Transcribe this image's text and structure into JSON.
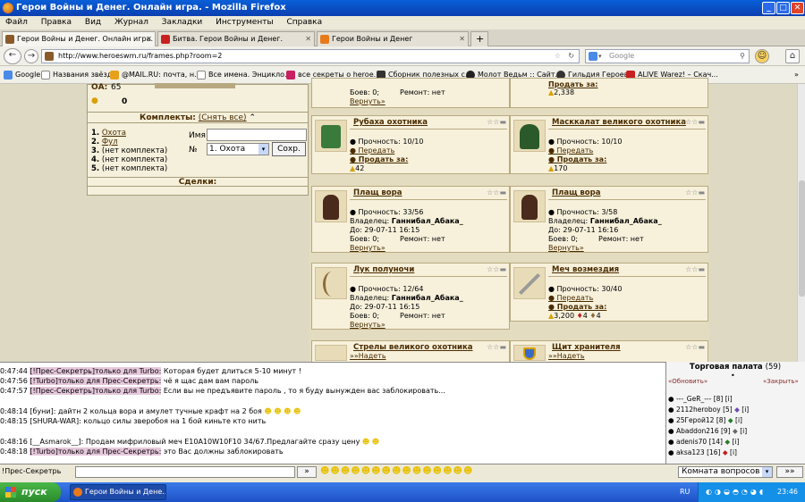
{
  "window": {
    "title": "Герои Войны и Денег. Онлайн игра. - Mozilla Firefox"
  },
  "menu": [
    "Файл",
    "Правка",
    "Вид",
    "Журнал",
    "Закладки",
    "Инструменты",
    "Справка"
  ],
  "tabs": [
    "Герои Войны и Денег. Онлайн игра.",
    "Битва. Герои Войны и Денег.",
    "Герои Войны и Денег"
  ],
  "nav": {
    "url": "http://www.heroeswm.ru/frames.php?room=2",
    "search_placeholder": "Google"
  },
  "bookmarks": [
    "Google",
    "Названия звёзд",
    "@MAIL.RU: почта, н...",
    "Все имена. Энцикло...",
    "все секреты о heroe...",
    "Сборник полезных с...",
    "Молот Ведьм :: Сайт...",
    "Гильдия Героев",
    "ALIVE Warez! – Скач..."
  ],
  "side": {
    "oa_label": "ОА:",
    "oa_value": "65",
    "gold_value": "0",
    "sets_title": "Комплекты:",
    "sets_remove": "(Снять все)",
    "name_label": "Имя",
    "num_label": "№",
    "num_select": "1. Охота",
    "save_button": "Сохр.",
    "deals_title": "Сделки:",
    "sets": [
      {
        "n": "1.",
        "t": "Охота",
        "link": true
      },
      {
        "n": "2.",
        "t": "Фул",
        "link": true
      },
      {
        "n": "3.",
        "t": "(нет комплекта)",
        "link": false
      },
      {
        "n": "4.",
        "t": "(нет комплекта)",
        "link": false
      },
      {
        "n": "5.",
        "t": "(нет комплекта)",
        "link": false
      }
    ]
  },
  "items": {
    "top_left": {
      "fight": "Боев: 0;",
      "repair": "Ремонт: нет",
      "return": "Вернуть»"
    },
    "top_right": {
      "sell": "Продать за:",
      "price": "2,338"
    },
    "i1": {
      "name": "Рубаха охотника",
      "dur": "Прочность: 10/10",
      "transfer": "Передать",
      "sell": "Продать за:",
      "price": "42"
    },
    "i2": {
      "name": "Масккалат великого охотника",
      "dur": "Прочность: 10/10",
      "transfer": "Передать",
      "sell": "Продать за:",
      "price": "170"
    },
    "i3": {
      "name": "Плащ вора",
      "dur": "Прочность: 33/56",
      "owner_label": "Владелец:",
      "owner": "Ганнибал_Абака_",
      "until": "До: 29-07-11 16:15",
      "fights": "Боев: 0;",
      "repair": "Ремонт: нет",
      "return": "Вернуть»"
    },
    "i4": {
      "name": "Плащ вора",
      "dur": "Прочность: 3/58",
      "owner_label": "Владелец:",
      "owner": "Ганнибал_Абака_",
      "until": "До: 29-07-11 16:16",
      "fights": "Боев: 0;",
      "repair": "Ремонт: нет",
      "return": "Вернуть»"
    },
    "i5": {
      "name": "Лук полуночи",
      "dur": "Прочность: 12/64",
      "owner_label": "Владелец:",
      "owner": "Ганнибал_Абака_",
      "until": "До: 29-07-11 16:15",
      "fights": "Боев: 0;",
      "repair": "Ремонт: нет",
      "return": "Вернуть»"
    },
    "i6": {
      "name": "Меч возмездия",
      "dur": "Прочность: 30/40",
      "transfer": "Передать",
      "sell": "Продать за:",
      "price": "3,200",
      "att": "4",
      "def": "4"
    },
    "i7": {
      "name": "Стрелы великого охотника",
      "wear": "»»Надеть"
    },
    "i8": {
      "name": "Щит хранителя",
      "wear": "»»Надеть"
    }
  },
  "chat": [
    {
      "time": "0:47:44",
      "nick": "[!Прес-Секретрь]",
      "to": "только для Turbo:",
      "text": "Которая будет длиться 5-10 минут !",
      "pink": true
    },
    {
      "time": "0:47:56",
      "nick": "[!Turbo]",
      "to": "только для Прес-Секретрь:",
      "text": "чё я щас дам вам пароль",
      "pink": true
    },
    {
      "time": "0:47:57",
      "nick": "[!Прес-Секретрь]",
      "to": "только для Turbo:",
      "text": "Если вы не предъявите пароль , то я буду вынужден вас заблокировать...",
      "pink": true
    },
    {
      "time": "0:48:14",
      "nick": "[буни]:",
      "to": "",
      "text": "дайтн 2 кольца вора и амулет тучные крафт на 2 боя",
      "pink": false
    },
    {
      "time": "0:48:15",
      "nick": "[SHURA-WAR]:",
      "to": "",
      "text": "кольцо силы зверобоя на 1 бой киньте кто нить",
      "pink": false
    },
    {
      "time": "0:48:16",
      "nick": "[__Asmarok__]:",
      "to": "",
      "text": "Продам мифриловый меч E10A10W10F10 34/67.Предлагайте сразу цену",
      "pink": false
    },
    {
      "time": "0:48:18",
      "nick": "[!Turbo]",
      "to": "только для Прес-Секретрь:",
      "text": "это Вас должны заблокировать",
      "pink": true
    }
  ],
  "trade": {
    "title": "Торговая палата",
    "count": "(59)",
    "refresh": "«Обновить»",
    "close": "«Закрыть»",
    "users": [
      "---_GeR_--- [8]",
      "2112heroboy [5]",
      "25Герой12 [8]",
      "Abaddon216 [9]",
      "adenis70 [14]",
      "aksa123 [16]"
    ]
  },
  "chatinput": {
    "recipient": "!Прес-Секретрь",
    "send": "»",
    "room": "Комната вопросов",
    "go": "»»"
  },
  "taskbar": {
    "start": "пуск",
    "task": "Герои Войны и Дене...",
    "lang": "RU",
    "time": "23:46"
  }
}
